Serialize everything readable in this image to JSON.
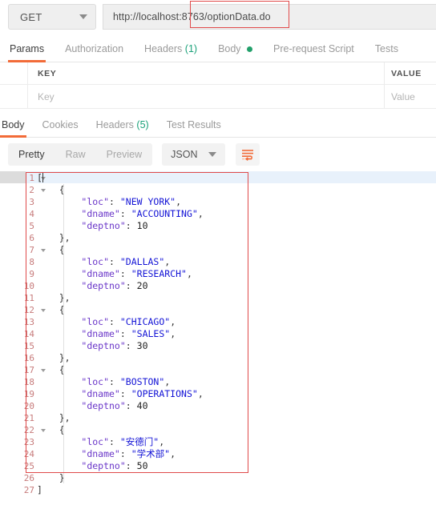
{
  "request": {
    "method": "GET",
    "method_caret_icon": "chevron-down-icon",
    "url": "http://localhost:8763/optionData.do",
    "url_highlight": ":8763/optionData.do"
  },
  "request_tabs": [
    {
      "label": "Params",
      "active": true
    },
    {
      "label": "Authorization",
      "active": false
    },
    {
      "label": "Headers",
      "count": "(1)",
      "active": false
    },
    {
      "label": "Body",
      "dot": true,
      "active": false
    },
    {
      "label": "Pre-request Script",
      "active": false
    },
    {
      "label": "Tests",
      "active": false
    }
  ],
  "params_table": {
    "columns": [
      "KEY",
      "VALUE"
    ],
    "placeholders": {
      "key": "Key",
      "value": "Value"
    }
  },
  "response_tabs": [
    {
      "label": "Body",
      "active": true
    },
    {
      "label": "Cookies",
      "active": false
    },
    {
      "label": "Headers",
      "count": "(5)",
      "active": false
    },
    {
      "label": "Test Results",
      "active": false
    }
  ],
  "format_bar": {
    "views": [
      {
        "label": "Pretty",
        "active": true
      },
      {
        "label": "Raw",
        "active": false
      },
      {
        "label": "Preview",
        "active": false
      }
    ],
    "language": "JSON",
    "language_caret_icon": "chevron-down-icon",
    "wrap_icon": "word-wrap-icon"
  },
  "colors": {
    "accent_orange": "#f26b38",
    "green_badge": "#1aa179",
    "highlight_red": "#e04a4a",
    "json_key": "#6b37c9",
    "json_string": "#1414d6",
    "active_line": "#e8f1fb"
  },
  "response_body": {
    "line_count": 27,
    "records": [
      {
        "loc": "NEW YORK",
        "dname": "ACCOUNTING",
        "deptno": 10
      },
      {
        "loc": "DALLAS",
        "dname": "RESEARCH",
        "deptno": 20
      },
      {
        "loc": "CHICAGO",
        "dname": "SALES",
        "deptno": 30
      },
      {
        "loc": "BOSTON",
        "dname": "OPERATIONS",
        "deptno": 40
      },
      {
        "loc": "安德门",
        "dname": "学术部",
        "deptno": 50
      }
    ],
    "lines": [
      {
        "num": 1,
        "fold": true,
        "text": "[",
        "cursor": true
      },
      {
        "num": 2,
        "fold": true,
        "text": "    {"
      },
      {
        "num": 3,
        "fold": false,
        "key": "\"loc\"",
        "sep": ": ",
        "str": "\"NEW YORK\"",
        "tail": ","
      },
      {
        "num": 4,
        "fold": false,
        "key": "\"dname\"",
        "sep": ": ",
        "str": "\"ACCOUNTING\"",
        "tail": ","
      },
      {
        "num": 5,
        "fold": false,
        "key": "\"deptno\"",
        "sep": ": ",
        "num_val": "10"
      },
      {
        "num": 6,
        "fold": false,
        "text": "    },"
      },
      {
        "num": 7,
        "fold": true,
        "text": "    {"
      },
      {
        "num": 8,
        "fold": false,
        "key": "\"loc\"",
        "sep": ": ",
        "str": "\"DALLAS\"",
        "tail": ","
      },
      {
        "num": 9,
        "fold": false,
        "key": "\"dname\"",
        "sep": ": ",
        "str": "\"RESEARCH\"",
        "tail": ","
      },
      {
        "num": 10,
        "fold": false,
        "key": "\"deptno\"",
        "sep": ": ",
        "num_val": "20"
      },
      {
        "num": 11,
        "fold": false,
        "text": "    },"
      },
      {
        "num": 12,
        "fold": true,
        "text": "    {"
      },
      {
        "num": 13,
        "fold": false,
        "key": "\"loc\"",
        "sep": ": ",
        "str": "\"CHICAGO\"",
        "tail": ","
      },
      {
        "num": 14,
        "fold": false,
        "key": "\"dname\"",
        "sep": ": ",
        "str": "\"SALES\"",
        "tail": ","
      },
      {
        "num": 15,
        "fold": false,
        "key": "\"deptno\"",
        "sep": ": ",
        "num_val": "30"
      },
      {
        "num": 16,
        "fold": false,
        "text": "    },"
      },
      {
        "num": 17,
        "fold": true,
        "text": "    {"
      },
      {
        "num": 18,
        "fold": false,
        "key": "\"loc\"",
        "sep": ": ",
        "str": "\"BOSTON\"",
        "tail": ","
      },
      {
        "num": 19,
        "fold": false,
        "key": "\"dname\"",
        "sep": ": ",
        "str": "\"OPERATIONS\"",
        "tail": ","
      },
      {
        "num": 20,
        "fold": false,
        "key": "\"deptno\"",
        "sep": ": ",
        "num_val": "40"
      },
      {
        "num": 21,
        "fold": false,
        "text": "    },"
      },
      {
        "num": 22,
        "fold": true,
        "text": "    {"
      },
      {
        "num": 23,
        "fold": false,
        "key": "\"loc\"",
        "sep": ": ",
        "str": "\"安德门\"",
        "tail": ","
      },
      {
        "num": 24,
        "fold": false,
        "key": "\"dname\"",
        "sep": ": ",
        "str": "\"学术部\"",
        "tail": ","
      },
      {
        "num": 25,
        "fold": false,
        "key": "\"deptno\"",
        "sep": ": ",
        "num_val": "50"
      },
      {
        "num": 26,
        "fold": false,
        "text": "    }"
      },
      {
        "num": 27,
        "fold": false,
        "text": "]"
      }
    ]
  }
}
